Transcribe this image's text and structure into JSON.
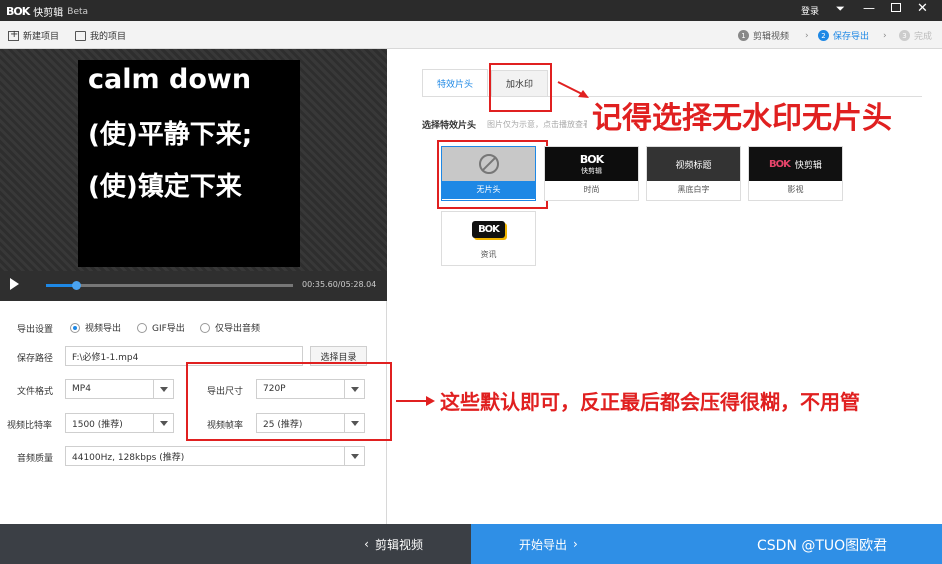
{
  "app": {
    "title": "快剪辑",
    "edition": "Beta",
    "login": "登录"
  },
  "toolbar": {
    "new_project": "新建项目",
    "my_projects": "我的项目"
  },
  "steps": [
    {
      "num": "1",
      "label": "剪辑视频"
    },
    {
      "num": "2",
      "label": "保存导出"
    },
    {
      "num": "3",
      "label": "完成"
    }
  ],
  "preview": {
    "line1": "calm down",
    "line2": "(使)平静下来;",
    "line3": "(使)镇定下来",
    "time": "00:35.60/05:28.04",
    "progress": 0.12
  },
  "export": {
    "settings_label": "导出设置",
    "options": [
      "视频导出",
      "GIF导出",
      "仅导出音频"
    ],
    "save_path_label": "保存路径",
    "save_path_value": "F:\\必修1-1.mp4",
    "browse_button": "选择目录",
    "format_label": "文件格式",
    "format_value": "MP4",
    "size_label": "导出尺寸",
    "size_value": "720P",
    "bitrate_label": "视频比特率",
    "bitrate_value": "1500 (推荐)",
    "framerate_label": "视频帧率",
    "framerate_value": "25 (推荐)",
    "audio_label": "音频质量",
    "audio_value": "44100Hz, 128kbps (推荐)"
  },
  "tabs": {
    "effects": "特效片头",
    "watermark": "加水印"
  },
  "effects": {
    "section_title": "选择特效片头",
    "hint": "图片仅为示意，点击播放查看效果",
    "items": [
      {
        "name": "无片头"
      },
      {
        "name": "时尚",
        "logo": "快剪辑"
      },
      {
        "name": "黑底白字",
        "thumb_text": "视频标题"
      },
      {
        "name": "影视",
        "logo": "快剪辑"
      },
      {
        "name": "资讯"
      }
    ]
  },
  "annotations": {
    "top": "记得选择无水印无片头",
    "middle": "这些默认即可，反正最后都会压得很糊，不用管"
  },
  "bottom": {
    "back": "剪辑视频",
    "start_export": "开始导出",
    "watermark": "CSDN @TUO图欧君"
  },
  "colors": {
    "accent": "#1e88e5",
    "annotation": "#e02020",
    "titlebar": "#2b2b2b",
    "export_button": "#2f8fe6"
  }
}
